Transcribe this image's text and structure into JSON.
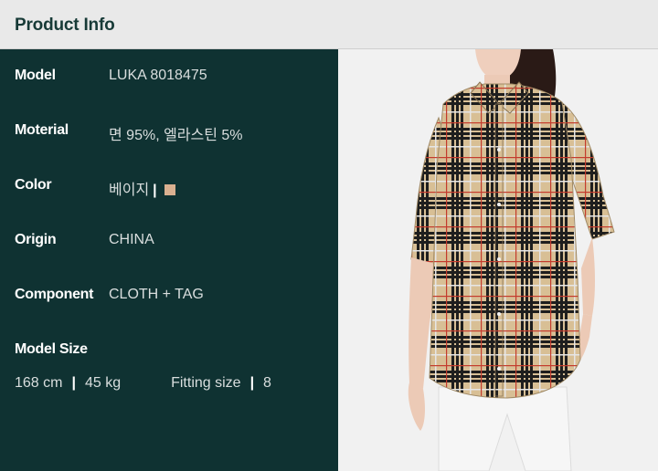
{
  "header": {
    "title": "Product Info"
  },
  "info": {
    "rows": [
      {
        "label": "Model",
        "value": "LUKA 8018475"
      },
      {
        "label": "Moterial",
        "value": "면 95%, 엘라스틴 5%"
      },
      {
        "label": "Color",
        "value": "베이지"
      },
      {
        "label": "Origin",
        "value": "CHINA"
      },
      {
        "label": "Component",
        "value": "CLOTH + TAG"
      }
    ],
    "color_swatch": "#d9b090",
    "model_size_label": "Model Size",
    "height": "168 cm",
    "weight": "45 kg",
    "fitting_label": "Fitting size",
    "fitting_value": "8"
  },
  "colors": {
    "panel": "#0f3232",
    "header": "#e9e9e9",
    "title": "#173a37"
  },
  "photo": {
    "subject": "model-wearing-beige-check-shirt"
  }
}
